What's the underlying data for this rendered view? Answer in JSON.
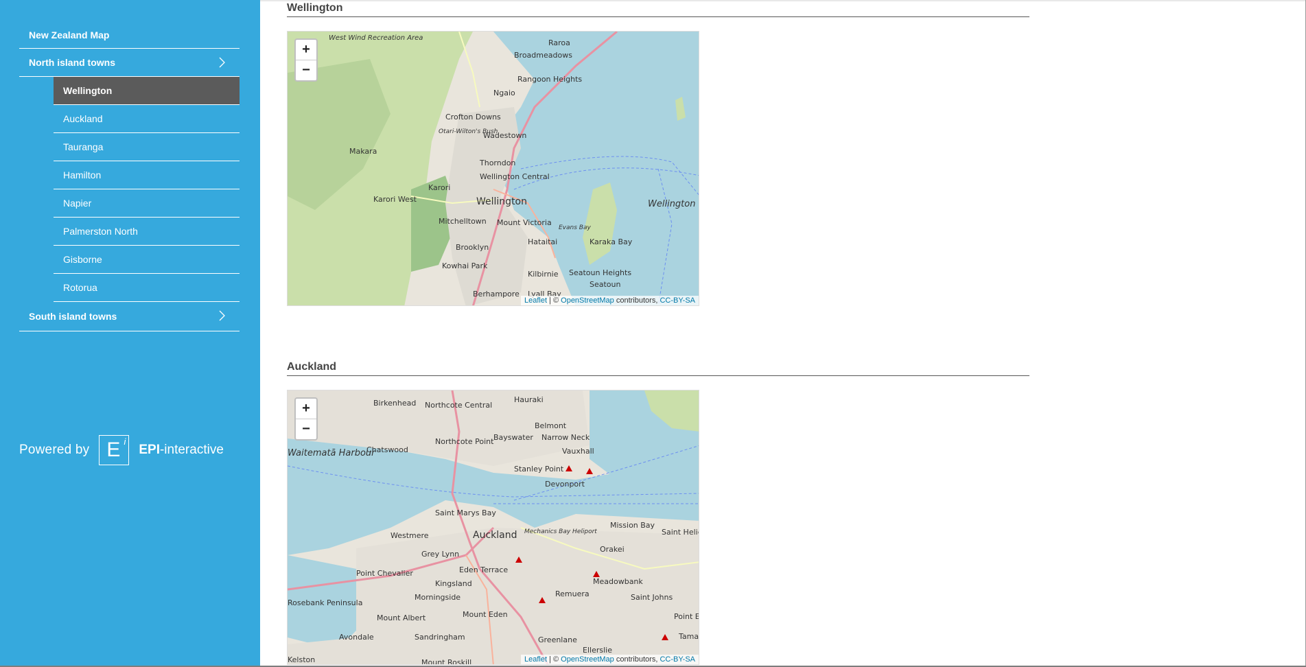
{
  "sidebar": {
    "title": "New Zealand Map",
    "north_section": "North island towns",
    "north_towns": [
      "Wellington",
      "Auckland",
      "Tauranga",
      "Hamilton",
      "Napier",
      "Palmerston North",
      "Gisborne",
      "Rotorua"
    ],
    "south_section": "South island towns",
    "powered_by": "Powered by",
    "logo_letter": "E",
    "logo_sup": "i",
    "brand_bold": "EPI",
    "brand_rest": "-interactive"
  },
  "sections": [
    {
      "title": "Wellington",
      "zoom_in": "+",
      "zoom_out": "−",
      "attribution": {
        "leaflet": "Leaflet",
        "sep": " | © ",
        "osm": "OpenStreetMap",
        "contrib": " contributors, ",
        "license": "CC-BY-SA"
      },
      "labels": [
        "West Wind Recreation Area",
        "Raroa",
        "Broadmeadows",
        "Rangoon Heights",
        "Ngaio",
        "Crofton Downs",
        "Otari-Wilton's Bush",
        "Wadestown",
        "Makara",
        "Thorndon",
        "Wellington Central",
        "Karori",
        "Karori West",
        "Wellington",
        "Mitchelltown",
        "Mount Victoria",
        "Evans Bay",
        "Hataitai",
        "Karaka Bay",
        "Brooklyn",
        "Kowhai Park",
        "Kilbirnie",
        "Seatoun Heights",
        "Seatoun",
        "Berhampore",
        "Lyall Bay",
        "Wellington Harbour"
      ]
    },
    {
      "title": "Auckland",
      "zoom_in": "+",
      "zoom_out": "−",
      "attribution": {
        "leaflet": "Leaflet",
        "sep": " | © ",
        "osm": "OpenStreetMap",
        "contrib": " contributors, ",
        "license": "CC-BY-SA"
      },
      "labels": [
        "Birkenhead",
        "Northcote Central",
        "Hauraki",
        "Northcote Point",
        "Bayswater",
        "Narrow Neck",
        "Belmont",
        "Chatswood",
        "Vauxhall",
        "Waitematā Harbour",
        "Stanley Point",
        "Devonport",
        "Saint Marys Bay",
        "Westmere",
        "Auckland",
        "Mechanics Bay Heliport",
        "Mission Bay",
        "Saint Heliers",
        "Grey Lynn",
        "Orakei",
        "Point Chevalier",
        "Eden Terrace",
        "Kingsland",
        "Meadowbank",
        "Morningside",
        "Remuera",
        "Saint Johns",
        "Mount Albert",
        "Mount Eden",
        "Point England",
        "Avondale",
        "Sandringham",
        "Greenlane",
        "Ellerslie",
        "Tamaki",
        "Kelston",
        "Mount Roskill",
        "Rosebank Peninsula"
      ]
    }
  ],
  "colors": {
    "sidebar": "#36a9dd",
    "active_item": "#5b5b5b",
    "water": "#aad3df",
    "land": "#f2efe9",
    "park": "#c8dfa8"
  }
}
